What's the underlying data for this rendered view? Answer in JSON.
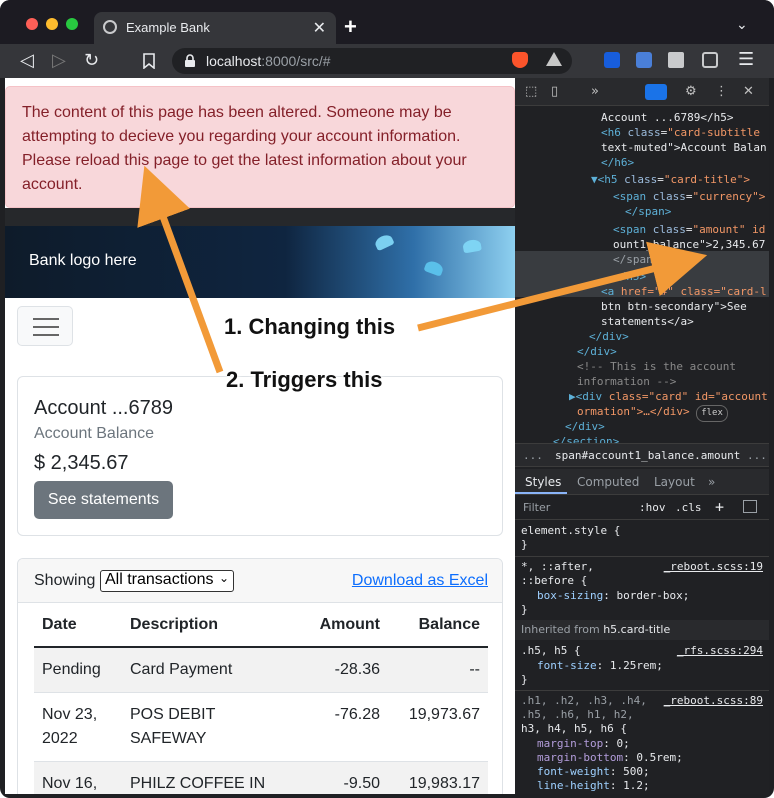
{
  "browser": {
    "tab_title": "Example Bank",
    "tab_close": "✕",
    "new_tab": "+",
    "tab_menu": "⌄",
    "url_host": "localhost",
    "url_rest": ":8000/src/#",
    "icons": [
      "back-icon",
      "forward-icon",
      "reload-icon",
      "bookmark-icon",
      "lock-icon",
      "brave-shield-icon",
      "bat-icon",
      "bitwarden-icon",
      "translate-icon",
      "extensions-icon",
      "wallet-icon",
      "menu-icon"
    ]
  },
  "page": {
    "alert_text": "The content of this page has been altered. Someone may be attempting to decieve you regarding your account information. Please reload this page to get the latest information about your account.",
    "banner_text": "Bank logo here",
    "account": {
      "title": "Account ...6789",
      "subtitle": "Account Balance",
      "balance": "$ 2,345.67",
      "button": "See statements"
    },
    "transactions": {
      "showing_label": "Showing",
      "filter_value": "All transactions",
      "download_link": "Download as Excel",
      "headers": {
        "date": "Date",
        "description": "Description",
        "amount": "Amount",
        "balance": "Balance"
      },
      "rows": [
        {
          "date": "Pending",
          "description": "Card Payment",
          "amount": "-28.36",
          "balance": "--"
        },
        {
          "date": "Nov 23, 2022",
          "description": "POS DEBIT SAFEWAY",
          "amount": "-76.28",
          "balance": "19,973.67"
        },
        {
          "date": "Nov 16, 2022",
          "description": "PHILZ COFFEE IN SAN",
          "amount": "-9.50",
          "balance": "19,983.17"
        }
      ]
    }
  },
  "devtools": {
    "elements_lines": {
      "l1": "Account ...6789</h5>",
      "l2_tag": "<h6",
      "l2_attr": "class",
      "l2_val": "\"card-subtitle",
      "l3": "text-muted\">Account Balan",
      "l4": "</h6>",
      "l5_tag": "▼<h5",
      "l5_val": "\"card-title\">",
      "l6_tag": "<span",
      "l6_val": "\"currency\">",
      "l7": "</span>",
      "l8_tag": "<span",
      "l8_val": "\"amount\" id",
      "l9": "ount1_balance\">2,345.67",
      "l10": "</span> == $0",
      "l11": "</h5>",
      "l12_tag": "<a",
      "l12_val": "href=\"#\" class=\"card-l",
      "l13": "btn btn-secondary\">See",
      "l14": "statements</a>",
      "l15": "</div>",
      "l16": "</div>",
      "l17": "<!-- This is the account",
      "l18": "information -->",
      "l19_tag": "▶<div",
      "l19_val": "class=\"card\" id=\"account",
      "l20": "ormation\">…</div>",
      "l20_badge": "flex",
      "l21": "</div>",
      "l22": "</section>"
    },
    "breadcrumb_dots": "...",
    "breadcrumb": "span#account1_balance.amount",
    "breadcrumb_more": "...",
    "tabs": [
      "Styles",
      "Computed",
      "Layout",
      "»"
    ],
    "filter_placeholder": "Filter",
    "filter_hov": ":hov",
    "filter_cls": ".cls",
    "rules": {
      "element_style": "element.style {",
      "element_close": "}",
      "r1_sel": "*, ::after,",
      "r1_sel2": "::before {",
      "r1_src": "_reboot.scss:19",
      "r1_prop": "box-sizing",
      "r1_val": "border-box;",
      "r1_close": "}",
      "inherited": "Inherited from",
      "inherited_from": "h5.card-title",
      "r2_sel": ".h5, h5 {",
      "r2_src": "_rfs.scss:294",
      "r2_prop": "font-size",
      "r2_val": "1.25rem;",
      "r2_close": "}",
      "r3_sel1": ".h1, .h2, .h3, .h4,",
      "r3_sel2": ".h5, .h6, h1, h2,",
      "r3_sel3": "h3, h4, h5, h6 {",
      "r3_src": "_reboot.scss:89",
      "r3_p1": "margin-top",
      "r3_v1": "0;",
      "r3_p2": "margin-bottom",
      "r3_v2": "0.5rem;",
      "r3_p3": "font-weight",
      "r3_v3": "500;",
      "r3_p4": "line-height",
      "r3_v4": "1.2;"
    }
  },
  "annotations": {
    "a1": "1. Changing this",
    "a2": "2. Triggers this",
    "arrow_color": "#f29a38"
  }
}
